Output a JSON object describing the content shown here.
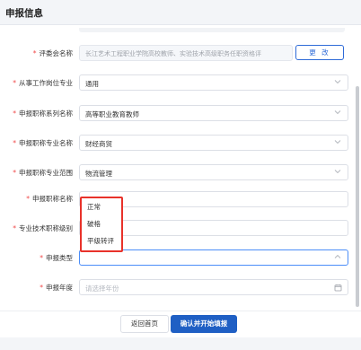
{
  "header": {
    "title": "申报信息"
  },
  "form": {
    "reviewer": {
      "label": "评委会名称",
      "value": "长江艺术工程职业学院高校教师、实验技术高级职务任职资格评",
      "change_label": "更 改"
    },
    "position": {
      "label": "从事工作岗位专业",
      "value": "通用"
    },
    "series": {
      "label": "申报职称系列名称",
      "value": "高等职业教育教师"
    },
    "major": {
      "label": "申报职称专业名称",
      "value": "财经商贸"
    },
    "scope": {
      "label": "申报职称专业范围",
      "value": "物流管理"
    },
    "title_name": {
      "label": "申报职称名称"
    },
    "tech_level": {
      "label": "专业技术职称级别"
    },
    "apply_type": {
      "label": "申报类型",
      "value": ""
    },
    "apply_year": {
      "label": "申报年度",
      "placeholder": "请选择年份"
    }
  },
  "dropdown": {
    "options": [
      "正常",
      "破格",
      "平级转评"
    ]
  },
  "footer": {
    "back_label": "返回首页",
    "confirm_label": "确认并开始填报"
  },
  "icons": {
    "select": "chevron-down-icon",
    "open": "chevron-up-icon",
    "date": "calendar-icon"
  }
}
